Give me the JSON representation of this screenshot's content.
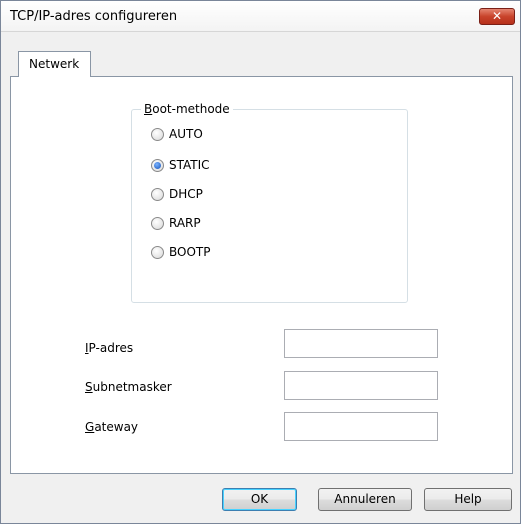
{
  "window": {
    "title": "TCP/IP-adres configureren",
    "close_glyph": "✕"
  },
  "tabs": [
    {
      "label": "Netwerk"
    }
  ],
  "boot_method": {
    "legend_first": "B",
    "legend_rest": "oot-methode",
    "options": [
      {
        "label": "AUTO",
        "checked": false
      },
      {
        "label": "STATIC",
        "checked": true
      },
      {
        "label": "DHCP",
        "checked": false
      },
      {
        "label": "RARP",
        "checked": false
      },
      {
        "label": "BOOTP",
        "checked": false
      }
    ]
  },
  "fields": {
    "ip": {
      "label_first": "I",
      "label_rest": "P-adres",
      "value": ""
    },
    "subnet": {
      "label_first": "S",
      "label_rest": "ubnetmasker",
      "value": ""
    },
    "gateway": {
      "label_first": "G",
      "label_rest": "ateway",
      "value": ""
    }
  },
  "buttons": {
    "ok": "OK",
    "cancel": "Annuleren",
    "help": "Help"
  }
}
